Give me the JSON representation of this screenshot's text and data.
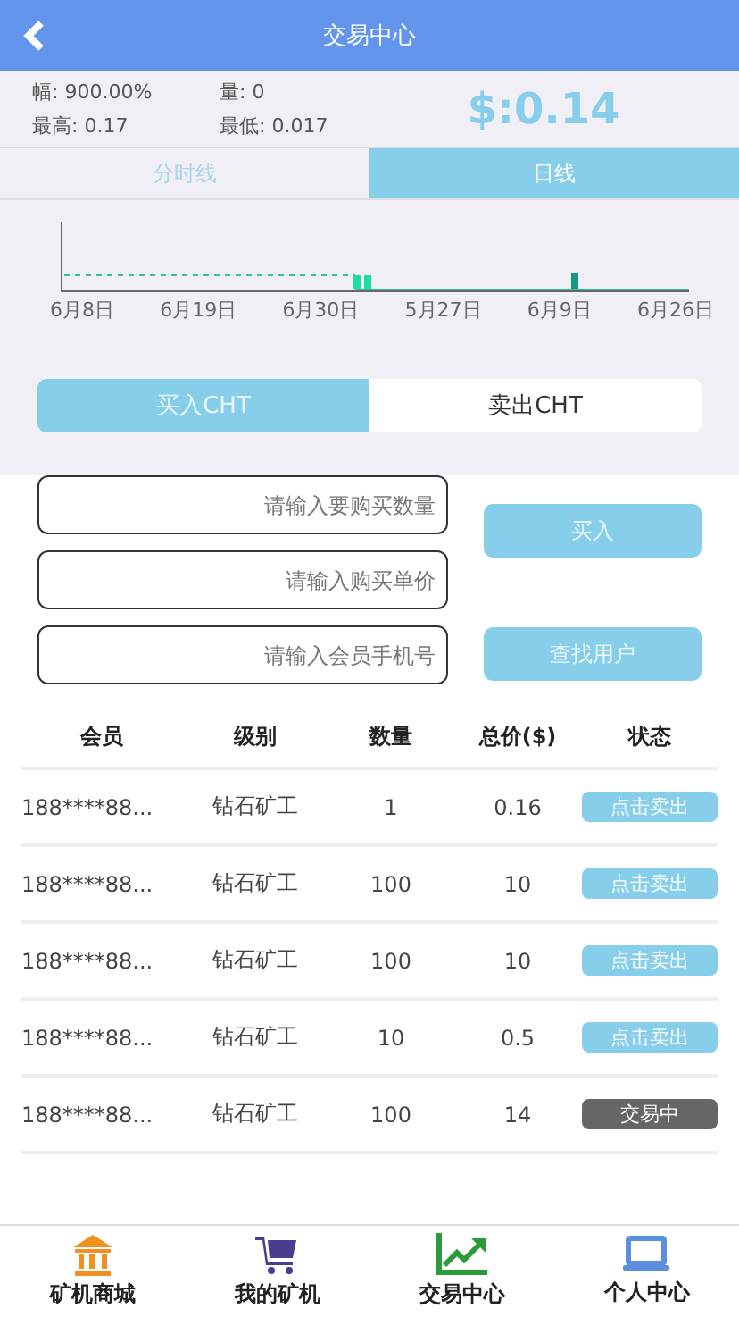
{
  "header": {
    "title": "交易中心"
  },
  "stats": [
    {
      "label": "幅: 900.00%"
    },
    {
      "label": "量: 0"
    },
    {
      "label": "最高: 0.17"
    },
    {
      "label": "最低: 0.017"
    }
  ],
  "price": "$:0.14",
  "chart_tabs": [
    {
      "label": "分时线",
      "selected": false
    },
    {
      "label": "日线",
      "selected": true
    }
  ],
  "chart_dates": [
    "6月8日",
    "6月19日",
    "6月30日",
    "5月27日",
    "6月9日",
    "6月26日"
  ],
  "trade_tabs": [
    {
      "label": "买入CHT",
      "selected": true
    },
    {
      "label": "卖出CHT",
      "selected": false
    }
  ],
  "fields": [
    {
      "placeholder": "请输入要购买数量"
    },
    {
      "placeholder": "请输入购买单价"
    },
    {
      "placeholder": "请输入会员手机号"
    }
  ],
  "buttons": [
    "买入",
    "查找用户"
  ],
  "table": {
    "columns": [
      "会员",
      "级别",
      "数量",
      "总价($)",
      "状态"
    ],
    "rows": [
      {
        "member": "188****88...",
        "level": "钻石矿工",
        "qty": "1",
        "total": "0.16",
        "status": "点击卖出",
        "kind": "sell"
      },
      {
        "member": "188****88...",
        "level": "钻石矿工",
        "qty": "100",
        "total": "10",
        "status": "点击卖出",
        "kind": "sell"
      },
      {
        "member": "188****88...",
        "level": "钻石矿工",
        "qty": "100",
        "total": "10",
        "status": "点击卖出",
        "kind": "sell"
      },
      {
        "member": "188****88...",
        "level": "钻石矿工",
        "qty": "10",
        "total": "0.5",
        "status": "点击卖出",
        "kind": "sell"
      },
      {
        "member": "188****88...",
        "level": "钻石矿工",
        "qty": "100",
        "total": "14",
        "status": "交易中",
        "kind": "trading"
      }
    ]
  },
  "nav": [
    {
      "label": "矿机商城",
      "kind": "shop"
    },
    {
      "label": "我的矿机",
      "kind": "cart"
    },
    {
      "label": "交易中心",
      "kind": "chart"
    },
    {
      "label": "个人中心",
      "kind": "laptop"
    }
  ]
}
